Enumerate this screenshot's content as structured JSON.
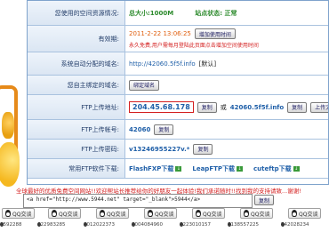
{
  "space": {
    "label": "您使用的空间资源情况:",
    "total": "总大小:1000M",
    "status": "站点状态: 正常"
  },
  "validity": {
    "label": "有效期:",
    "date": "2011-2-22 13:06:25",
    "add_button": "增加使用时间",
    "notice": "永久免费,用户需每月登陆此页面点击增加空间使用时间"
  },
  "domain": {
    "label": "系统自动分配的域名:",
    "value": "http://42060.5f5f.info",
    "suffix": "[默认]"
  },
  "bind": {
    "label": "您自主绑定的域名:",
    "button": "绑定域名"
  },
  "ftp_address": {
    "label": "FTP上传地址:",
    "ip": "204.45.68.178",
    "copy": "复制",
    "or": "或",
    "host": "42060.5f5f.info",
    "copy2": "复制",
    "upload": "上传文件"
  },
  "ftp_account": {
    "label": "FTP上传帐号:",
    "value": "42060",
    "copy": "复制"
  },
  "ftp_password": {
    "label": "FTP上传密码:",
    "value": "v13246955227v.*",
    "copy": "复制"
  },
  "ftp_software": {
    "label": "常用FTP软件下载:",
    "items": [
      "FlashFXP下载",
      "LeapFTP下载",
      "cuteftp下载"
    ]
  },
  "notice": "全球最好的优质免费空间网站!!欢迎帮站长推荐给你的好朋友一起体验!我们承诺随时!!找到我的支持请致...谢谢!",
  "code": "<a href=\"http://www.5944.net\" target=\"_blank\">5944</a>",
  "copy_code": "复制",
  "qq": {
    "button": "QQ交谈",
    "numbers": [
      "1592288",
      "422983285",
      "1012022373",
      "1004084960",
      "1223010157",
      "1138557225",
      "742028234"
    ]
  },
  "colors": {
    "border": "#7fa3cc",
    "label_bg": "#dbe6f3",
    "accent_red": "#d42020",
    "link_blue": "#1f5fa8"
  }
}
